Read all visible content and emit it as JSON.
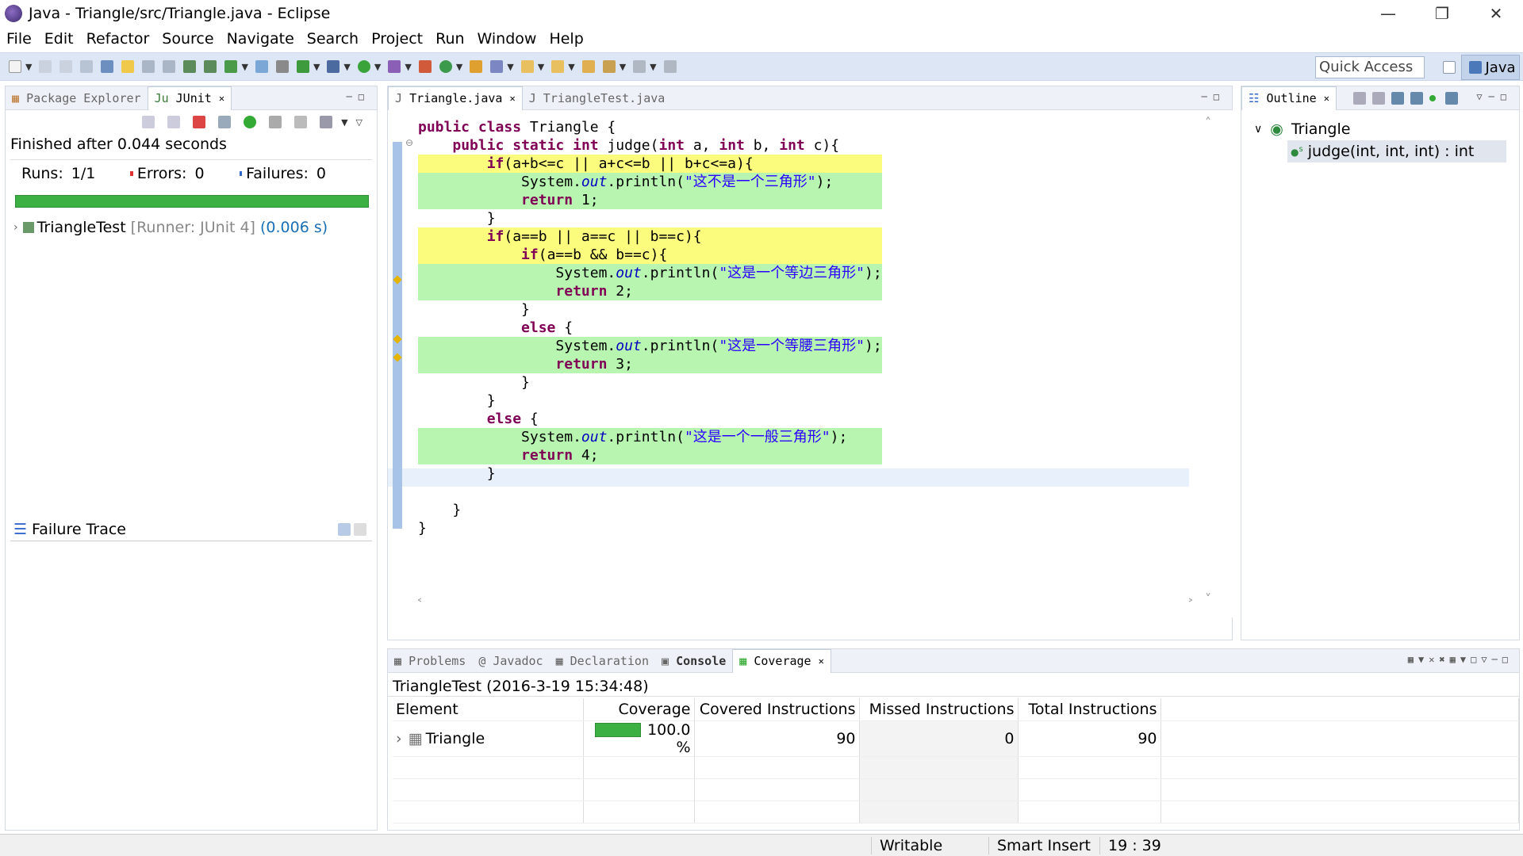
{
  "window": {
    "title": "Java - Triangle/src/Triangle.java - Eclipse"
  },
  "menu": [
    "File",
    "Edit",
    "Refactor",
    "Source",
    "Navigate",
    "Search",
    "Project",
    "Run",
    "Window",
    "Help"
  ],
  "toolbar": {
    "quick_access": "Quick Access",
    "perspective": "Java"
  },
  "left_panel": {
    "tabs": [
      "Package Explorer",
      "JUnit"
    ],
    "finished": "Finished after 0.044 seconds",
    "runs_label": "Runs:",
    "runs": "1/1",
    "errors_label": "Errors:",
    "errors": "0",
    "failures_label": "Failures:",
    "failures": "0",
    "progress": 1.0,
    "test_name": "TriangleTest",
    "test_meta": "[Runner: JUnit 4]",
    "test_time": "(0.006 s)",
    "failure_trace": "Failure Trace"
  },
  "editor": {
    "tabs": [
      "Triangle.java",
      "TriangleTest.java"
    ],
    "code": [
      "public class Triangle {",
      "    public static int judge(int a, int b, int c){",
      "        if(a+b<=c || a+c<=b || b+c<=a){",
      "            System.out.println(\"这不是一个三角形\");",
      "            return 1;",
      "        }",
      "        if(a==b || a==c || b==c){",
      "            if(a==b && b==c){",
      "                System.out.println(\"这是一个等边三角形\");",
      "                return 2;",
      "            }",
      "            else {",
      "                System.out.println(\"这是一个等腰三角形\");",
      "                return 3;",
      "            }",
      "        }",
      "        else {",
      "            System.out.println(\"这是一个一般三角形\");",
      "            return 4;",
      "        }",
      "",
      "    }",
      "}"
    ]
  },
  "outline": {
    "tab": "Outline",
    "class_name": "Triangle",
    "method": "judge(int, int, int) : int"
  },
  "bottom_panel": {
    "tabs": [
      "Problems",
      "Javadoc",
      "Declaration",
      "Console",
      "Coverage"
    ],
    "session": "TriangleTest (2016-3-19 15:34:48)",
    "columns": [
      "Element",
      "Coverage",
      "Covered Instructions",
      "Missed Instructions",
      "Total Instructions"
    ],
    "row": {
      "element": "Triangle",
      "coverage": "100.0 %",
      "covered": "90",
      "missed": "0",
      "total": "90"
    }
  },
  "status": {
    "writable": "Writable",
    "insert": "Smart Insert",
    "position": "19 : 39"
  },
  "colors": {
    "junit_green": "#3cb043",
    "toolbar_bg": "#dce6f4",
    "keyword": "#7f0055",
    "string": "#2a00ff",
    "covered_line": "#b8f5b0",
    "partial_line": "#fbfb7d"
  }
}
